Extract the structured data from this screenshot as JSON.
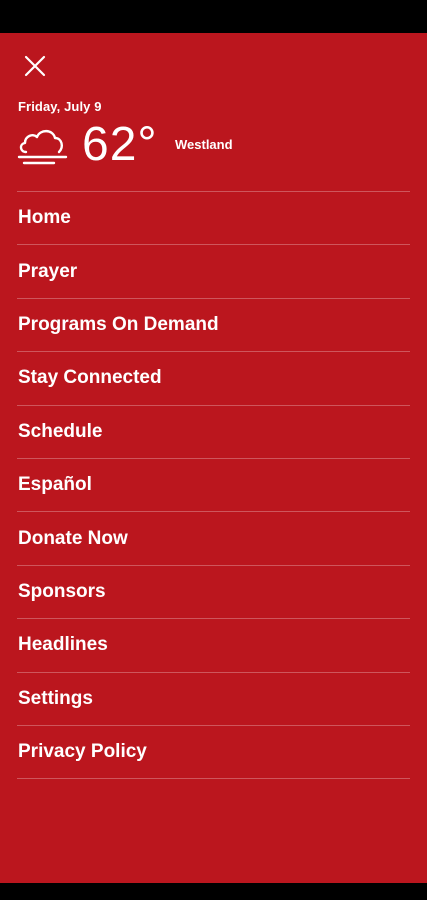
{
  "colors": {
    "drawer_bg": "#bb161e",
    "text": "#ffffff",
    "system_bars": "#000000"
  },
  "header": {
    "close_icon": "close-icon",
    "date": "Friday, July 9",
    "weather": {
      "icon": "cloudy-fog-icon",
      "temperature": "62°",
      "location": "Westland"
    }
  },
  "menu": {
    "items": [
      {
        "label": "Home"
      },
      {
        "label": "Prayer"
      },
      {
        "label": "Programs On Demand"
      },
      {
        "label": "Stay Connected"
      },
      {
        "label": "Schedule"
      },
      {
        "label": "Español"
      },
      {
        "label": "Donate Now"
      },
      {
        "label": "Sponsors"
      },
      {
        "label": "Headlines"
      },
      {
        "label": "Settings"
      },
      {
        "label": "Privacy Policy"
      }
    ]
  }
}
